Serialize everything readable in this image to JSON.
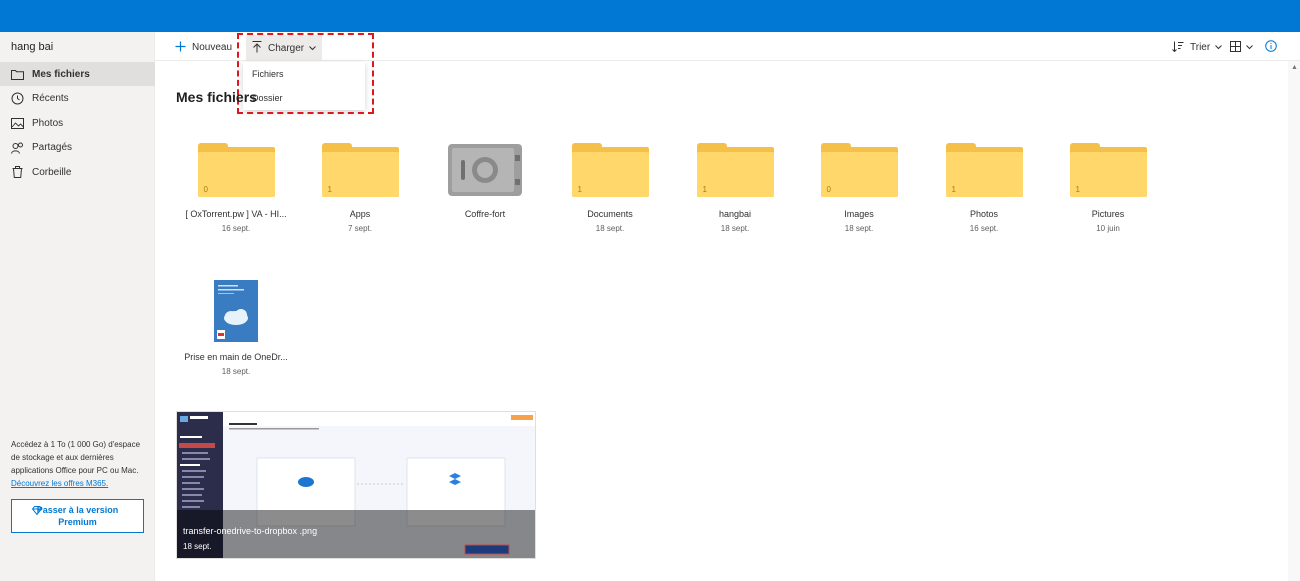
{
  "user": {
    "name": "hang bai"
  },
  "sidebar": {
    "items": [
      {
        "label": "Mes fichiers",
        "icon": "folder-icon",
        "active": true
      },
      {
        "label": "Récents",
        "icon": "recent-icon",
        "active": false
      },
      {
        "label": "Photos",
        "icon": "photo-icon",
        "active": false
      },
      {
        "label": "Partagés",
        "icon": "shared-icon",
        "active": false
      },
      {
        "label": "Corbeille",
        "icon": "trash-icon",
        "active": false
      }
    ],
    "promo_text": "Accédez à 1 To (1 000 Go) d'espace de stockage et aux dernières applications Office pour PC ou Mac.",
    "promo_link": "Découvrez les offres M365.",
    "premium_button": "Passer à la version Premium"
  },
  "toolbar": {
    "new_label": "Nouveau",
    "upload_label": "Charger",
    "sort_label": "Trier"
  },
  "upload_menu": {
    "items": [
      "Fichiers",
      "Dossier"
    ]
  },
  "main": {
    "title": "Mes fichiers",
    "items": [
      {
        "type": "folder",
        "name": "[ OxTorrent.pw ] VA - HI...",
        "date": "16 sept.",
        "count": "0"
      },
      {
        "type": "folder",
        "name": "Apps",
        "date": "7 sept.",
        "count": "1"
      },
      {
        "type": "vault",
        "name": "Coffre-fort",
        "date": "",
        "count": ""
      },
      {
        "type": "folder",
        "name": "Documents",
        "date": "18 sept.",
        "count": "1"
      },
      {
        "type": "folder",
        "name": "hangbai",
        "date": "18 sept.",
        "count": "1"
      },
      {
        "type": "folder",
        "name": "Images",
        "date": "18 sept.",
        "count": "0"
      },
      {
        "type": "folder",
        "name": "Photos",
        "date": "16 sept.",
        "count": "1"
      },
      {
        "type": "folder",
        "name": "Pictures",
        "date": "10 juin",
        "count": "1"
      }
    ],
    "file": {
      "name": "Prise en main de OneDr...",
      "date": "18 sept."
    },
    "image_file": {
      "name": "transfer-onedrive-to-dropbox .png",
      "date": "18 sept."
    }
  },
  "colors": {
    "accent": "#0078d4",
    "folder": "#ffd76a",
    "highlight": "#e0161f"
  }
}
